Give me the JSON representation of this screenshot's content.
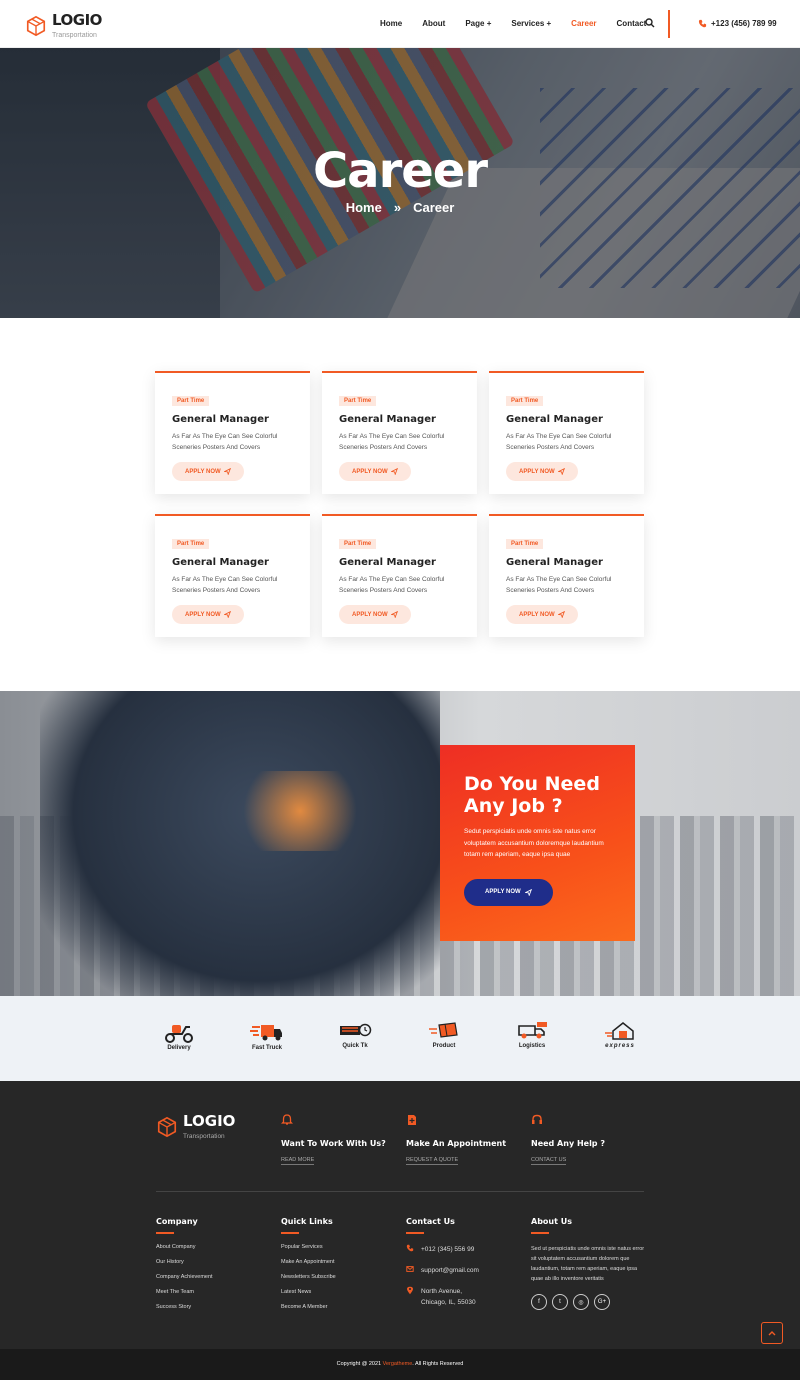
{
  "header": {
    "logo_name": "LOGIO",
    "logo_sub": "Transportation",
    "nav": [
      "Home",
      "About",
      "Page +",
      "Services +",
      "Career",
      "Contact"
    ],
    "active_nav": "Career",
    "phone": "+123 (456) 789 99"
  },
  "hero": {
    "title": "Career",
    "crumb_home": "Home",
    "crumb_sep": "»",
    "crumb_current": "Career"
  },
  "jobs": [
    {
      "tag": "Part Time",
      "title": "General Manager",
      "desc": "As Far As The Eye Can See Colorful Sceneries Posters And Covers",
      "btn": "APPLY NOW"
    },
    {
      "tag": "Part Time",
      "title": "General Manager",
      "desc": "As Far As The Eye Can See Colorful Sceneries Posters And Covers",
      "btn": "APPLY NOW"
    },
    {
      "tag": "Part Time",
      "title": "General Manager",
      "desc": "As Far As The Eye Can See Colorful Sceneries Posters And Covers",
      "btn": "APPLY NOW"
    },
    {
      "tag": "Part Time",
      "title": "General Manager",
      "desc": "As Far As The Eye Can See Colorful Sceneries Posters And Covers",
      "btn": "APPLY NOW"
    },
    {
      "tag": "Part Time",
      "title": "General Manager",
      "desc": "As Far As The Eye Can See Colorful Sceneries Posters And Covers",
      "btn": "APPLY NOW"
    },
    {
      "tag": "Part Time",
      "title": "General Manager",
      "desc": "As Far As The Eye Can See Colorful Sceneries Posters And Covers",
      "btn": "APPLY NOW"
    }
  ],
  "job_cta": {
    "title_line1": "Do You Need",
    "title_line2": "Any Job ?",
    "text": "Sedut perspiciatis unde omnis iste natus error voluptatem accusantium doloremque laudantium totam rem aperiam, eaque ipsa quae",
    "btn": "APPLY NOW"
  },
  "partners": [
    "Delivery",
    "Fast Truck",
    "Quick Tk",
    "Product",
    "Logistics",
    "express"
  ],
  "footer": {
    "logo_name": "LOGIO",
    "logo_sub": "Transportation",
    "cta": [
      {
        "title": "Want To Work With Us?",
        "link": "READ MORE",
        "icon": "bell-icon"
      },
      {
        "title": "Make An Appointment",
        "link": "REQUEST A QUOTE",
        "icon": "document-icon"
      },
      {
        "title": "Need Any Help ?",
        "link": "CONTACT US",
        "icon": "headset-icon"
      }
    ],
    "company": {
      "heading": "Company",
      "items": [
        "About Company",
        "Our History",
        "Company Achievement",
        "Meet The Team",
        "Success Story"
      ]
    },
    "quick_links": {
      "heading": "Quick Links",
      "items": [
        "Popular Services",
        "Make An Appointment",
        "Newsletters Subscribe",
        "Latest News",
        "Become A Member"
      ]
    },
    "contact": {
      "heading": "Contact Us",
      "phone": "+012 (345) 556 99",
      "email": "support@gmail.com",
      "address_line1": "North Avenue,",
      "address_line2": "Chicago, IL, 55030"
    },
    "about": {
      "heading": "About Us",
      "text": "Sed ut perspiciatis unde omnis iste natus error sit voluptatem accusantium dolorem que laudantium, totam rem aperiam, eaque ipsa quae ab illo inventore veritatis"
    },
    "socials": [
      "f",
      "t",
      "◎",
      "G+"
    ],
    "copyright_pre": "Copyright @ 2021 ",
    "copyright_brand": "Vergatheme",
    "copyright_post": ". All Rights Reserved"
  },
  "colors": {
    "accent": "#f15a24",
    "navy": "#1f2d8a",
    "dark": "#272727"
  }
}
